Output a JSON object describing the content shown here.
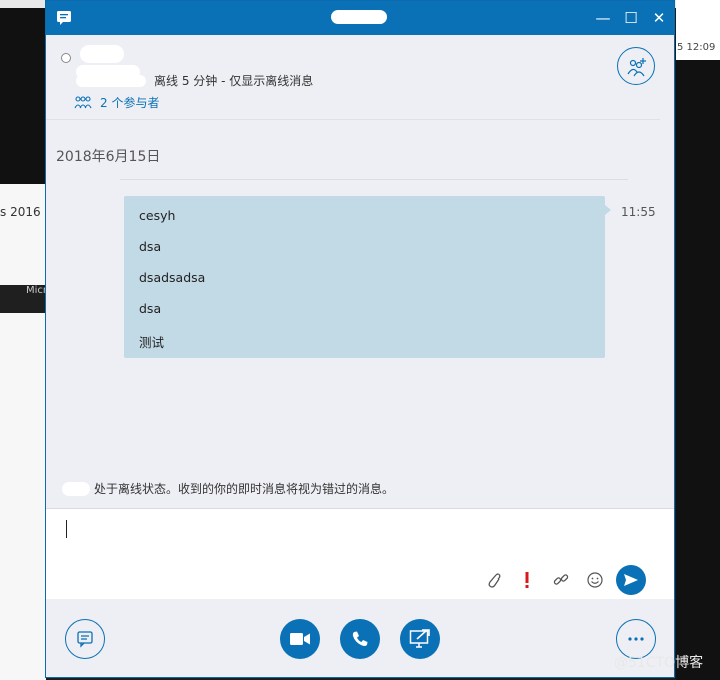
{
  "background": {
    "right_time": "5 12:09",
    "left_fragment_1": "s 2016",
    "left_fragment_2": "Micr"
  },
  "window": {
    "accent_color": "#0a71b6",
    "controls": {
      "minimize": "—",
      "maximize": "☐",
      "close": "✕"
    }
  },
  "header": {
    "status_text": "离线 5 分钟 - 仅显示离线消息",
    "participants_label": "2 个参与者"
  },
  "conversation": {
    "date": "2018年6月15日",
    "messages": [
      "cesyh",
      "dsa",
      "dsadsadsa",
      "dsa",
      "测试"
    ],
    "time": "11:55"
  },
  "offline_notice": "处于离线状态。收到的你的即时消息将视为错过的消息。",
  "compose": {
    "icons": [
      "attach-icon",
      "important-icon",
      "link-icon",
      "emoji-icon",
      "send-icon"
    ],
    "important_color": "#d9181e"
  },
  "bottom_bar": {
    "buttons": [
      "im-button",
      "video-button",
      "call-button",
      "share-screen-button",
      "more-button"
    ]
  },
  "watermark": "@51CTO博客"
}
